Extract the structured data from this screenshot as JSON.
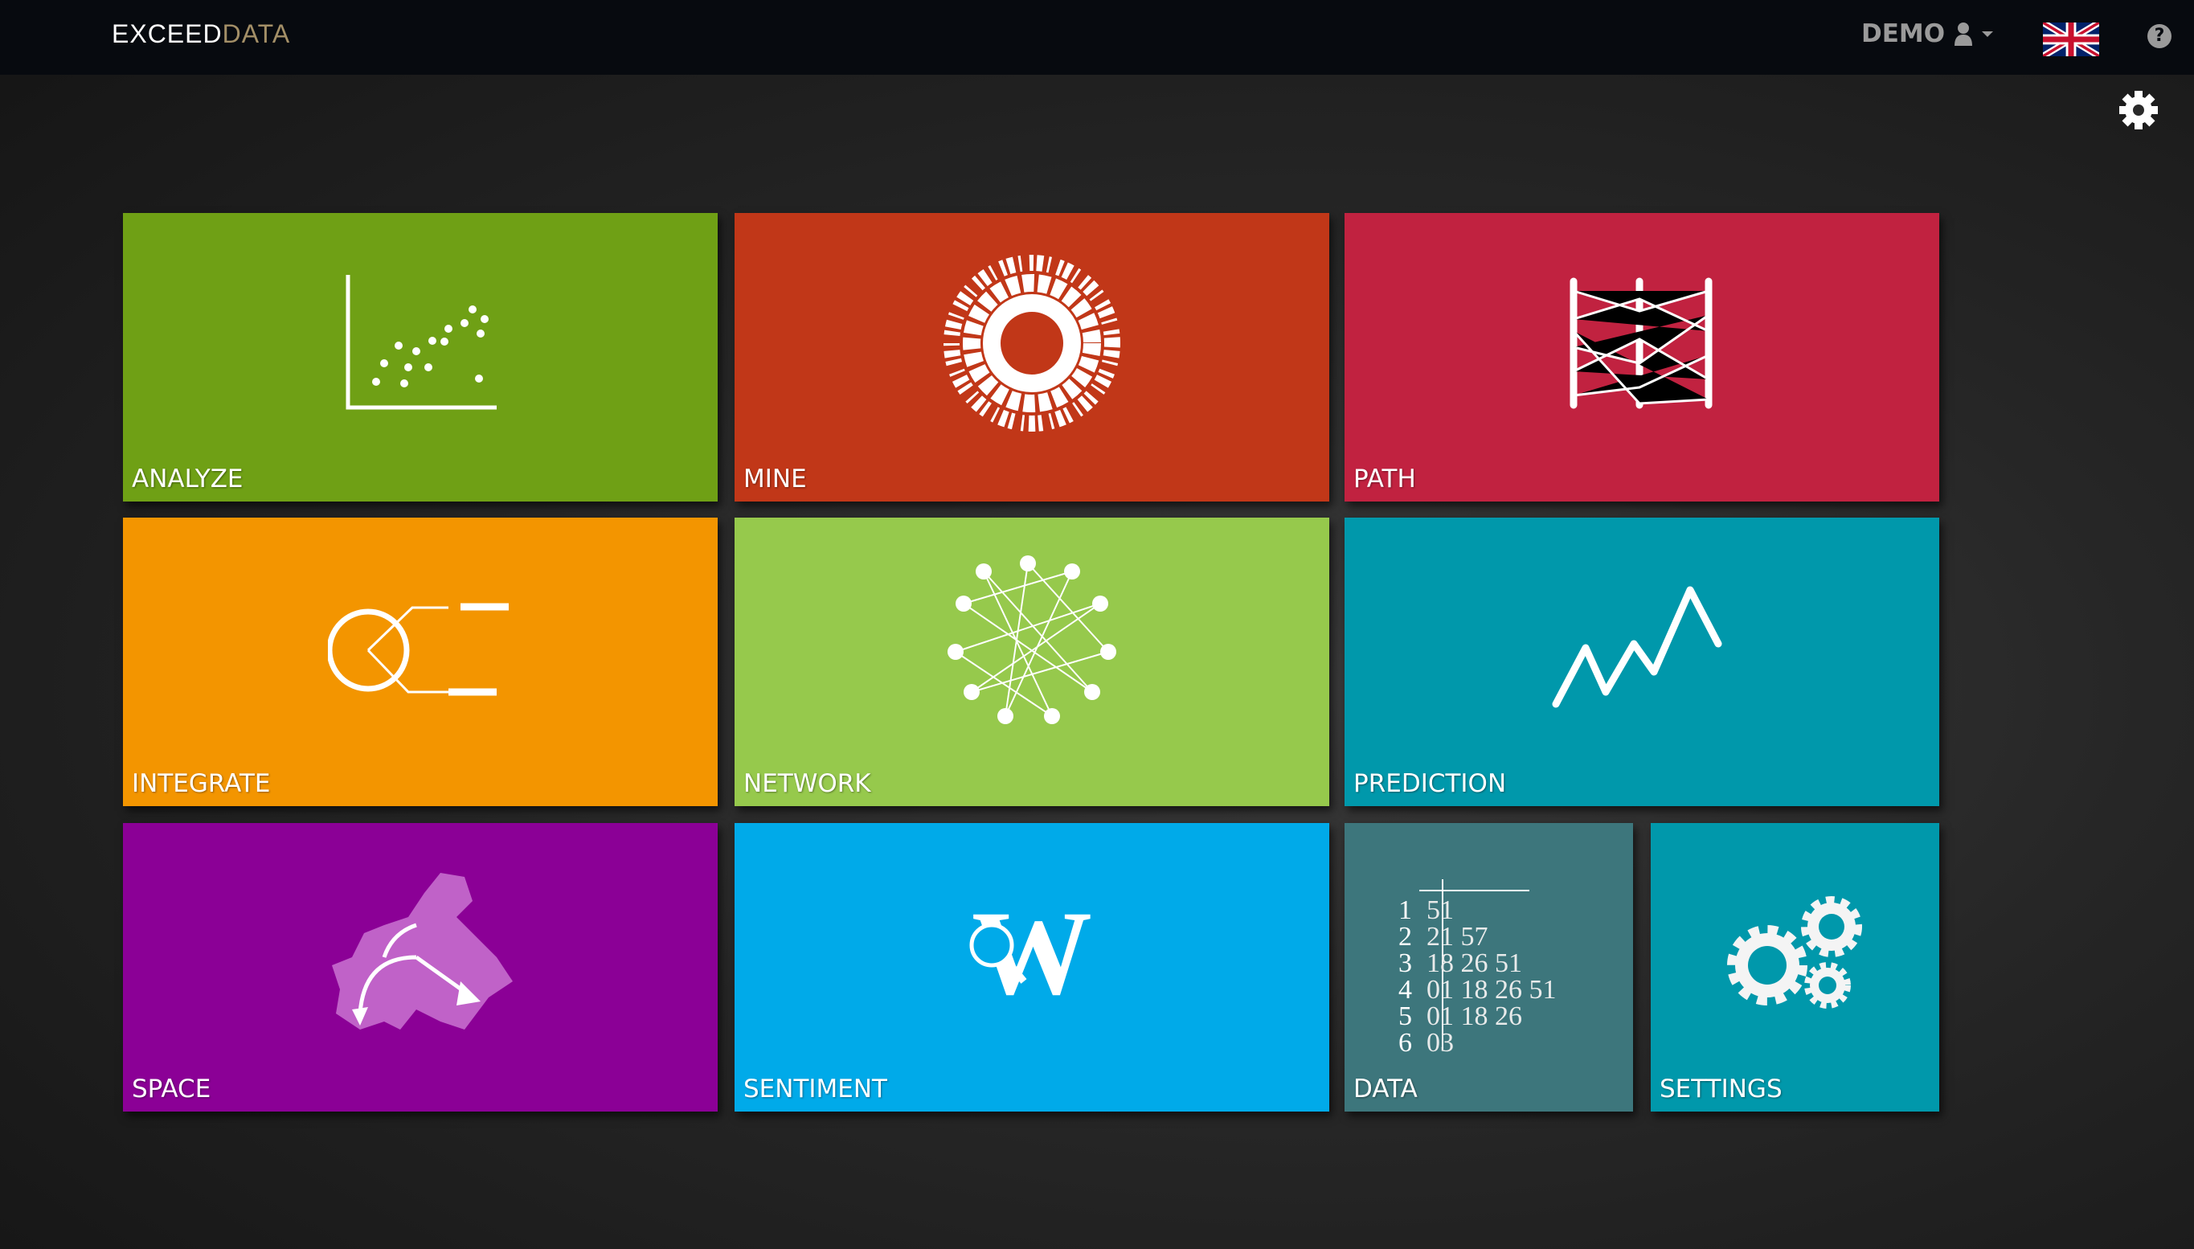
{
  "header": {
    "logo_part1": "EXCEED",
    "logo_part2": "DATA",
    "user": "DEMO",
    "icons": [
      "user-icon",
      "caret-down-icon",
      "uk-flag-icon",
      "help-icon"
    ]
  },
  "settings_icon": "gear-icon",
  "tiles": [
    {
      "label": "ANALYZE",
      "color": "#6fa015",
      "icon": "scatter-plot-icon"
    },
    {
      "label": "MINE",
      "color": "#c13718",
      "icon": "sunburst-icon"
    },
    {
      "label": "PATH",
      "color": "#c12240",
      "icon": "parallel-coordinates-icon"
    },
    {
      "label": "INTEGRATE",
      "color": "#f39500",
      "icon": "integrate-icon"
    },
    {
      "label": "NETWORK",
      "color": "#96c94c",
      "icon": "network-graph-icon"
    },
    {
      "label": "PREDICTION",
      "color": "#0098ab",
      "icon": "line-trend-icon"
    },
    {
      "label": "SPACE",
      "color": "#8b0096",
      "icon": "europe-map-icon"
    },
    {
      "label": "SENTIMENT",
      "color": "#00aae9",
      "icon": "w-search-icon"
    },
    {
      "label": "DATA",
      "color": "#3d767c",
      "icon": "stem-leaf-icon",
      "stem_leaf": [
        {
          "stem": "1",
          "leaves": "51"
        },
        {
          "stem": "2",
          "leaves": "21 57"
        },
        {
          "stem": "3",
          "leaves": "18 26 51"
        },
        {
          "stem": "4",
          "leaves": "01 18 26 51"
        },
        {
          "stem": "5",
          "leaves": "01 18 26"
        },
        {
          "stem": "6",
          "leaves": "03"
        }
      ]
    },
    {
      "label": "SETTINGS",
      "color": "#0098ab",
      "icon": "gears-icon"
    }
  ]
}
